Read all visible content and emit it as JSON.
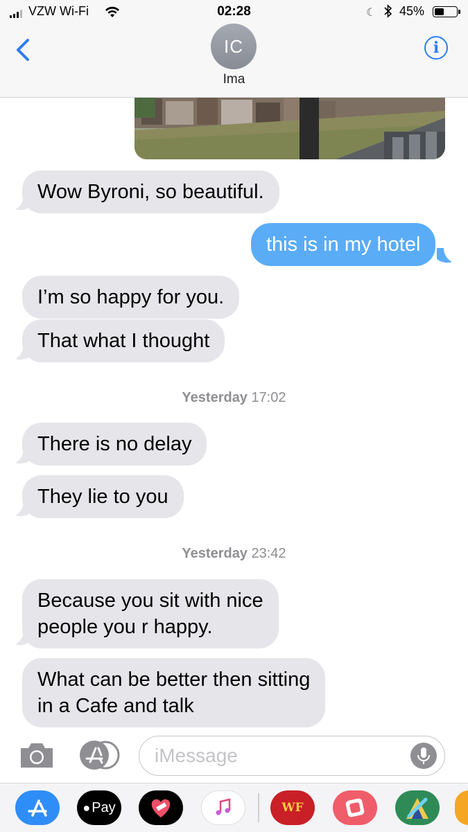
{
  "status_bar": {
    "carrier": "VZW Wi-Fi",
    "time": "02:28",
    "battery_percent": "45%",
    "battery_level": 0.45,
    "icons": [
      "signal-bars-icon",
      "wifi-icon",
      "moon-icon",
      "bluetooth-icon",
      "battery-icon"
    ]
  },
  "header": {
    "back_icon": "chevron-left-icon",
    "avatar_initials": "IC",
    "contact_name": "Ima",
    "info_label": "i",
    "accent_color": "#2d7cf6"
  },
  "conversation": {
    "photo_message": {
      "direction": "sent",
      "content": "photo"
    },
    "messages": [
      {
        "direction": "received",
        "text": "Wow Byroni, so beautiful."
      },
      {
        "direction": "sent",
        "text": "this is in my hotel"
      },
      {
        "direction": "received",
        "text": "I’m so happy for you."
      },
      {
        "direction": "received",
        "text": "That what I thought"
      },
      {
        "direction": "received",
        "text": "There is no delay"
      },
      {
        "direction": "received",
        "text": "They lie to you"
      },
      {
        "direction": "received",
        "text": "Because you sit with nice people you r happy.",
        "lines": [
          "Because you sit with nice",
          "people you r happy."
        ]
      },
      {
        "direction": "received",
        "text": "What can be better then sitting in a Cafe and talk",
        "lines": [
          "What can be better then sitting",
          "in a Cafe and talk"
        ]
      }
    ],
    "timestamps": [
      {
        "day": "Yesterday",
        "time": "17:02"
      },
      {
        "day": "Yesterday",
        "time": "23:42"
      }
    ],
    "colors": {
      "received_bubble": "#e5e5ea",
      "sent_bubble": "#5aacf7"
    }
  },
  "input_bar": {
    "placeholder": "iMessage",
    "icons": [
      "camera-icon",
      "app-store-icon",
      "microphone-icon"
    ]
  },
  "app_drawer": {
    "apps": [
      {
        "name": "app-store-icon",
        "label": ""
      },
      {
        "name": "apple-pay-icon",
        "label": "Pay"
      },
      {
        "name": "heart-sticker-icon",
        "label": ""
      },
      {
        "name": "music-icon",
        "label": ""
      },
      {
        "name": "wells-fargo-icon",
        "label": "WF"
      },
      {
        "name": "photo-app-icon",
        "label": ""
      },
      {
        "name": "game-app-icon",
        "label": ""
      },
      {
        "name": "partial-app-icon",
        "label": ""
      }
    ]
  }
}
